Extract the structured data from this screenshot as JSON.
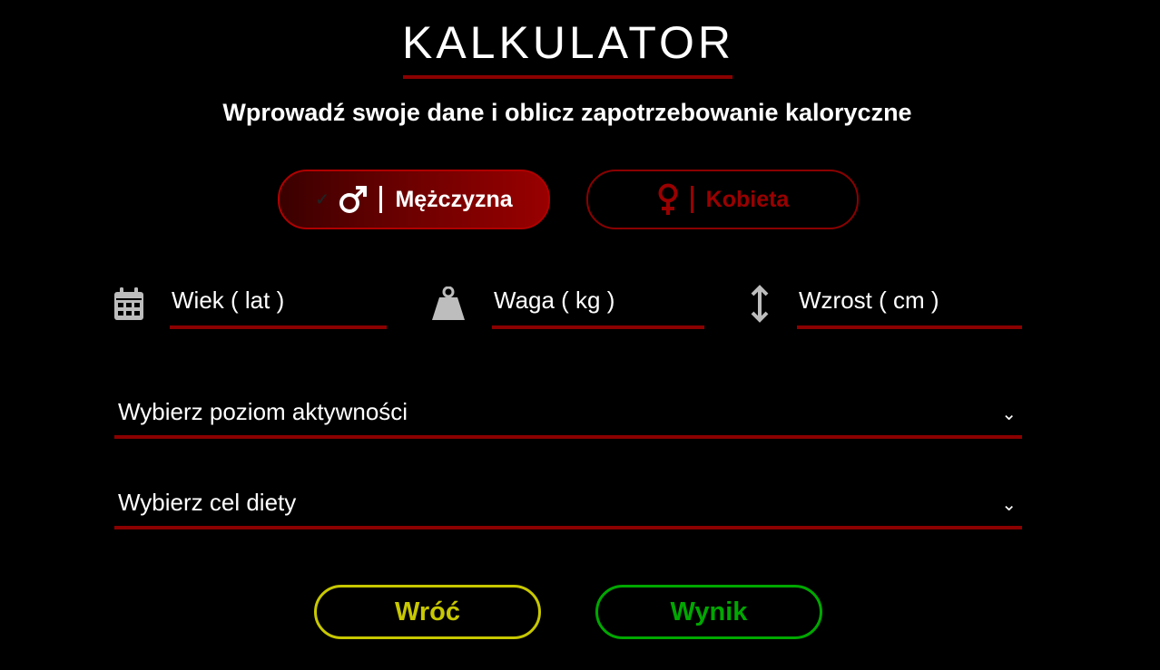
{
  "header": {
    "title": "KALKULATOR",
    "subtitle": "Wprowadź swoje dane i oblicz zapotrzebowanie kaloryczne"
  },
  "gender": {
    "male_label": "Mężczyzna",
    "female_label": "Kobieta",
    "male_icon": "male-symbol-icon",
    "female_icon": "female-symbol-icon",
    "selected": "male",
    "check_icon": "checkmark-icon"
  },
  "fields": {
    "age_placeholder": "Wiek ( lat )",
    "weight_placeholder": "Waga ( kg )",
    "height_placeholder": "Wzrost ( cm )",
    "age_icon": "calendar-icon",
    "weight_icon": "weight-icon",
    "height_icon": "vertical-arrows-icon"
  },
  "selects": {
    "activity_label": "Wybierz poziom aktywności",
    "goal_label": "Wybierz cel diety"
  },
  "buttons": {
    "back_label": "Wróć",
    "result_label": "Wynik"
  },
  "colors": {
    "accent": "#8b0000",
    "back": "#c8c800",
    "result": "#00a800"
  }
}
